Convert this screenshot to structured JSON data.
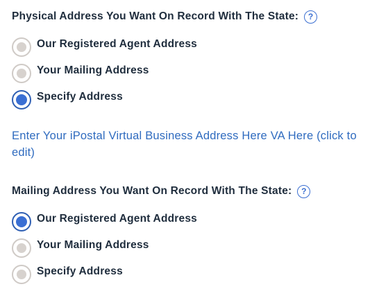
{
  "physical": {
    "title": "Physical Address You Want On Record With The State:",
    "help_icon": "question-circle-icon",
    "options": [
      {
        "label": "Our Registered Agent Address",
        "selected": false
      },
      {
        "label": "Your Mailing Address",
        "selected": false
      },
      {
        "label": "Specify Address",
        "selected": true
      }
    ]
  },
  "address_link": "Enter Your iPostal Virtual Business Address Here VA Here (click to edit)",
  "mailing": {
    "title": "Mailing Address You Want On Record With The State:",
    "help_icon": "question-circle-icon",
    "options": [
      {
        "label": "Our Registered Agent Address",
        "selected": true
      },
      {
        "label": "Your Mailing Address",
        "selected": false
      },
      {
        "label": "Specify Address",
        "selected": false
      }
    ]
  },
  "colors": {
    "accent": "#3a6fd3",
    "link": "#2f6bbf",
    "text": "#1f2d3d",
    "radio_unselected": "#d7d2ce"
  }
}
